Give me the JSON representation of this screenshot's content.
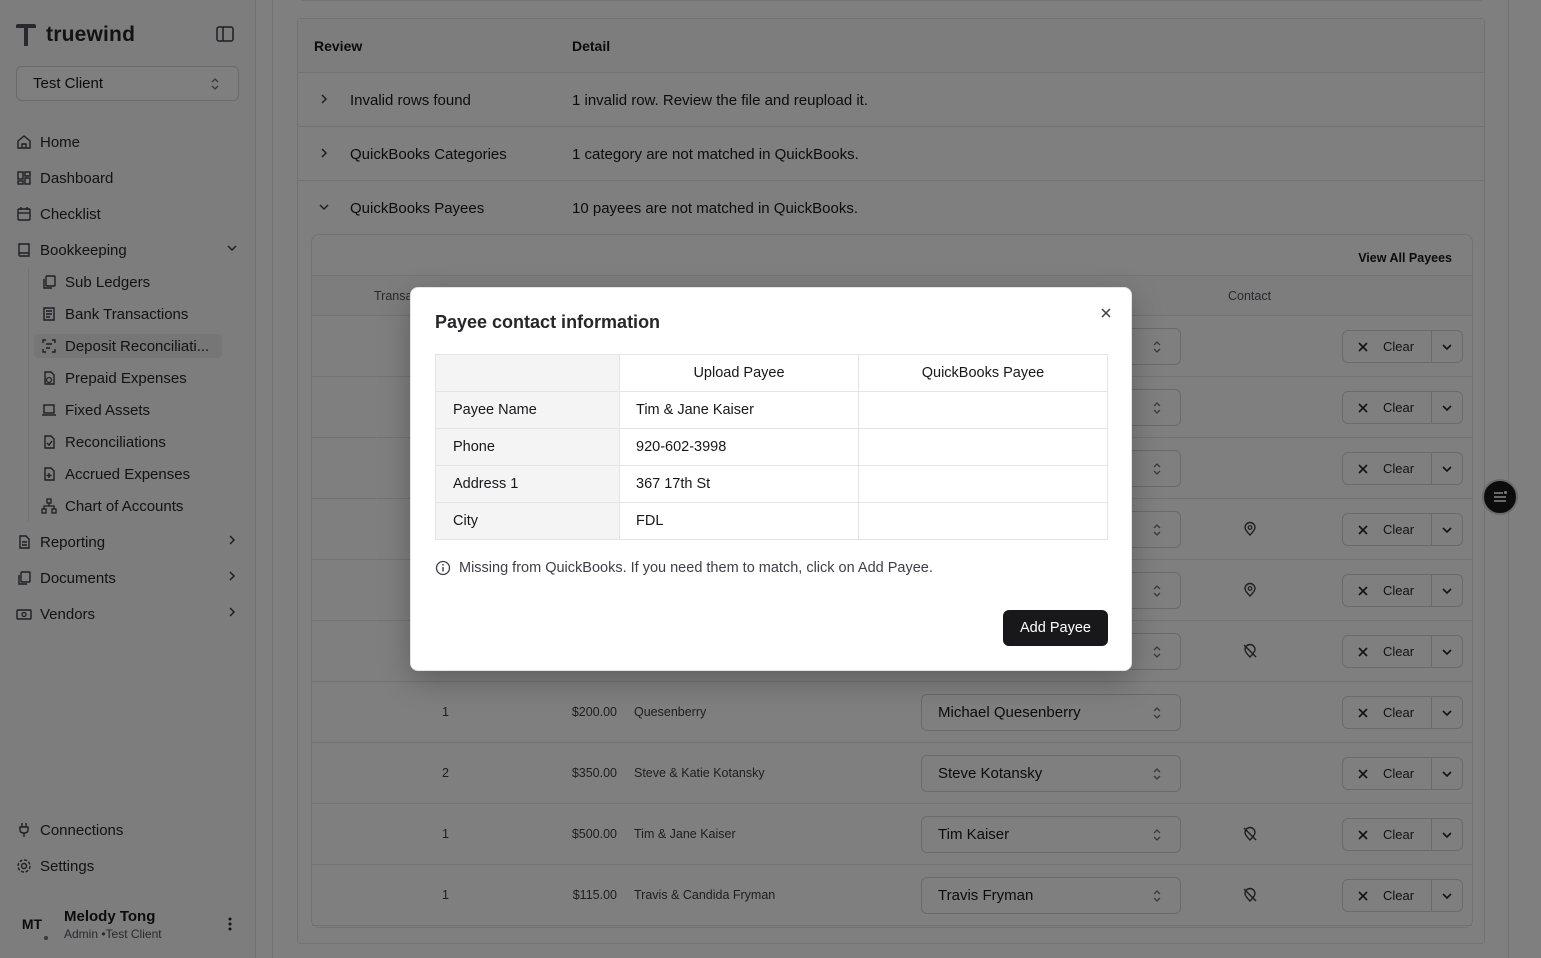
{
  "brand": {
    "name": "truewind"
  },
  "client_select": {
    "value": "Test Client"
  },
  "nav": {
    "home": "Home",
    "dashboard": "Dashboard",
    "checklist": "Checklist",
    "bookkeeping": "Bookkeeping",
    "sub": [
      "Sub Ledgers",
      "Bank Transactions",
      "Deposit Reconciliati...",
      "Prepaid Expenses",
      "Fixed Assets",
      "Reconciliations",
      "Accrued Expenses",
      "Chart of Accounts"
    ],
    "reporting": "Reporting",
    "documents": "Documents",
    "vendors": "Vendors",
    "connections": "Connections",
    "settings": "Settings"
  },
  "user": {
    "initials": "MT",
    "name": "Melody Tong",
    "role": "Admin •Test Client"
  },
  "review": {
    "headers": {
      "review": "Review",
      "detail": "Detail"
    },
    "rows": [
      {
        "title": "Invalid rows found",
        "detail": "1 invalid row. Review the file and reupload it."
      },
      {
        "title": "QuickBooks Categories",
        "detail": "1 category are not matched in QuickBooks."
      },
      {
        "title": "QuickBooks Payees",
        "detail": "10 payees are not matched in QuickBooks."
      }
    ]
  },
  "payees": {
    "view_all": "View All Payees",
    "headers": {
      "transactions": "Transa",
      "contact": "Contact"
    },
    "clear_label": "Clear",
    "rows": [
      {
        "count": "",
        "amount": "",
        "name": "",
        "match": "",
        "contact": ""
      },
      {
        "count": "",
        "amount": "",
        "name": "",
        "match": "",
        "contact": ""
      },
      {
        "count": "",
        "amount": "",
        "name": "",
        "match": "",
        "contact": ""
      },
      {
        "count": "",
        "amount": "",
        "name": "",
        "match": "",
        "contact": "contact-icon"
      },
      {
        "count": "",
        "amount": "",
        "name": "",
        "match": "",
        "contact": "contact-icon"
      },
      {
        "count": "",
        "amount": "",
        "name": "",
        "match": "",
        "contact": "contact-off-icon"
      },
      {
        "count": "1",
        "amount": "$200.00",
        "name": "Quesenberry",
        "match": "Michael Quesenberry",
        "contact": ""
      },
      {
        "count": "2",
        "amount": "$350.00",
        "name": "Steve & Katie Kotansky",
        "match": "Steve Kotansky",
        "contact": ""
      },
      {
        "count": "1",
        "amount": "$500.00",
        "name": "Tim & Jane Kaiser",
        "match": "Tim Kaiser",
        "contact": "contact-off-icon"
      },
      {
        "count": "1",
        "amount": "$115.00",
        "name": "Travis & Candida Fryman",
        "match": "Travis Fryman",
        "contact": "contact-off-icon"
      }
    ]
  },
  "modal": {
    "title": "Payee contact information",
    "columns": {
      "upload": "Upload Payee",
      "quickbooks": "QuickBooks Payee"
    },
    "rows": [
      {
        "label": "Payee Name",
        "upload": "Tim & Jane Kaiser",
        "quickbooks": ""
      },
      {
        "label": "Phone",
        "upload": "920-602-3998",
        "quickbooks": ""
      },
      {
        "label": "Address 1",
        "upload": "367 17th St",
        "quickbooks": ""
      },
      {
        "label": "City",
        "upload": "FDL",
        "quickbooks": ""
      }
    ],
    "info": "Missing from QuickBooks. If you need them to match, click on Add Payee.",
    "add_button": "Add Payee"
  }
}
